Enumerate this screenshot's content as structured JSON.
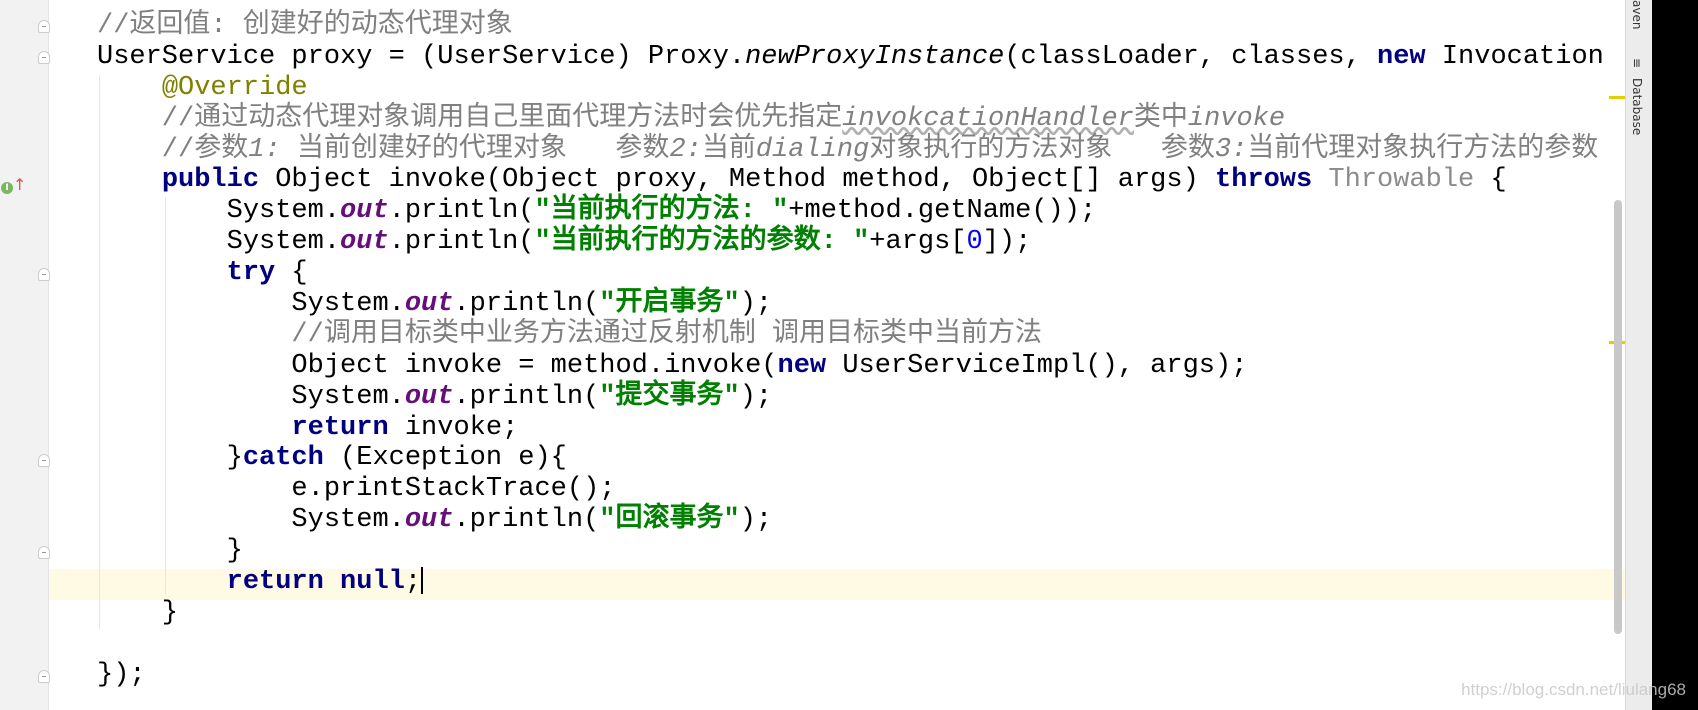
{
  "tool_windows": {
    "maven": "aven",
    "database": "Database"
  },
  "gutter": {
    "override_icon": "override-method-icon",
    "override_label": "I"
  },
  "watermark": "https://blog.csdn.net/liulang68",
  "colors": {
    "keyword": "#000080",
    "string": "#008000",
    "comment": "#808080",
    "annotation": "#808000",
    "static_field": "#660e7a",
    "current_line": "#fffae3"
  },
  "code_lines": [
    [
      [
        "//返回值: 创建好的动态代理对象",
        "cm"
      ]
    ],
    [
      [
        "UserService proxy = (UserService) Proxy.",
        ""
      ],
      [
        "newProxyInstance",
        "mth"
      ],
      [
        "(classLoader, classes, ",
        ""
      ],
      [
        "new",
        "kw"
      ],
      [
        " Invocation",
        ""
      ]
    ],
    [
      [
        "    ",
        ""
      ],
      [
        "@Override",
        "ann"
      ]
    ],
    [
      [
        "    //通过动态代理对象调用自己里面代理方法时会优先指定",
        "cm"
      ],
      [
        "invokcationHandler",
        "cmw"
      ],
      [
        "类中",
        "cm"
      ],
      [
        "invoke",
        "cmi"
      ]
    ],
    [
      [
        "    //参数",
        "cm"
      ],
      [
        "1:",
        "cmi"
      ],
      [
        " 当前创建好的代理对象   参数",
        "cm"
      ],
      [
        "2:",
        "cmi"
      ],
      [
        "当前",
        "cm"
      ],
      [
        "dialing",
        "cmi"
      ],
      [
        "对象执行的方法对象   参数",
        "cm"
      ],
      [
        "3:",
        "cmi"
      ],
      [
        "当前代理对象执行方法的参数",
        "cm"
      ]
    ],
    [
      [
        "    ",
        ""
      ],
      [
        "public",
        "kw"
      ],
      [
        " Object invoke(Object proxy, Method method, Object[] args) ",
        ""
      ],
      [
        "throws",
        "kw"
      ],
      [
        " ",
        ""
      ],
      [
        "Throwable",
        "unused"
      ],
      [
        " {",
        ""
      ]
    ],
    [
      [
        "        System.",
        ""
      ],
      [
        "out",
        "fld"
      ],
      [
        ".println(",
        ""
      ],
      [
        "\"当前执行的方法: \"",
        "str"
      ],
      [
        "+method.getName());",
        ""
      ]
    ],
    [
      [
        "        System.",
        ""
      ],
      [
        "out",
        "fld"
      ],
      [
        ".println(",
        ""
      ],
      [
        "\"当前执行的方法的参数: \"",
        "str"
      ],
      [
        "+args[",
        ""
      ],
      [
        "0",
        "num"
      ],
      [
        "]);",
        ""
      ]
    ],
    [
      [
        "        ",
        ""
      ],
      [
        "try",
        "kw"
      ],
      [
        " {",
        ""
      ]
    ],
    [
      [
        "            System.",
        ""
      ],
      [
        "out",
        "fld"
      ],
      [
        ".println(",
        ""
      ],
      [
        "\"开启事务\"",
        "str"
      ],
      [
        ");",
        ""
      ]
    ],
    [
      [
        "            //调用目标类中业务方法通过反射机制 调用目标类中当前方法",
        "cm"
      ]
    ],
    [
      [
        "            Object invoke = method.invoke(",
        ""
      ],
      [
        "new",
        "kw"
      ],
      [
        " UserServiceImpl(), args);",
        ""
      ]
    ],
    [
      [
        "            System.",
        ""
      ],
      [
        "out",
        "fld"
      ],
      [
        ".println(",
        ""
      ],
      [
        "\"提交事务\"",
        "str"
      ],
      [
        ");",
        ""
      ]
    ],
    [
      [
        "            ",
        ""
      ],
      [
        "return",
        "kw"
      ],
      [
        " invoke;",
        ""
      ]
    ],
    [
      [
        "        }",
        ""
      ],
      [
        "catch",
        "kw"
      ],
      [
        " (Exception e){",
        ""
      ]
    ],
    [
      [
        "            e.printStackTrace();",
        ""
      ]
    ],
    [
      [
        "            System.",
        ""
      ],
      [
        "out",
        "fld"
      ],
      [
        ".println(",
        ""
      ],
      [
        "\"回滚事务\"",
        "str"
      ],
      [
        ");",
        ""
      ]
    ],
    [
      [
        "        }",
        ""
      ]
    ],
    [
      [
        "        ",
        ""
      ],
      [
        "return",
        "kw"
      ],
      [
        " ",
        ""
      ],
      [
        "null",
        "kw"
      ],
      [
        ";",
        ""
      ]
    ],
    [
      [
        "    }",
        ""
      ]
    ],
    [
      [
        "",
        ""
      ]
    ],
    [
      [
        "});",
        ""
      ]
    ]
  ]
}
